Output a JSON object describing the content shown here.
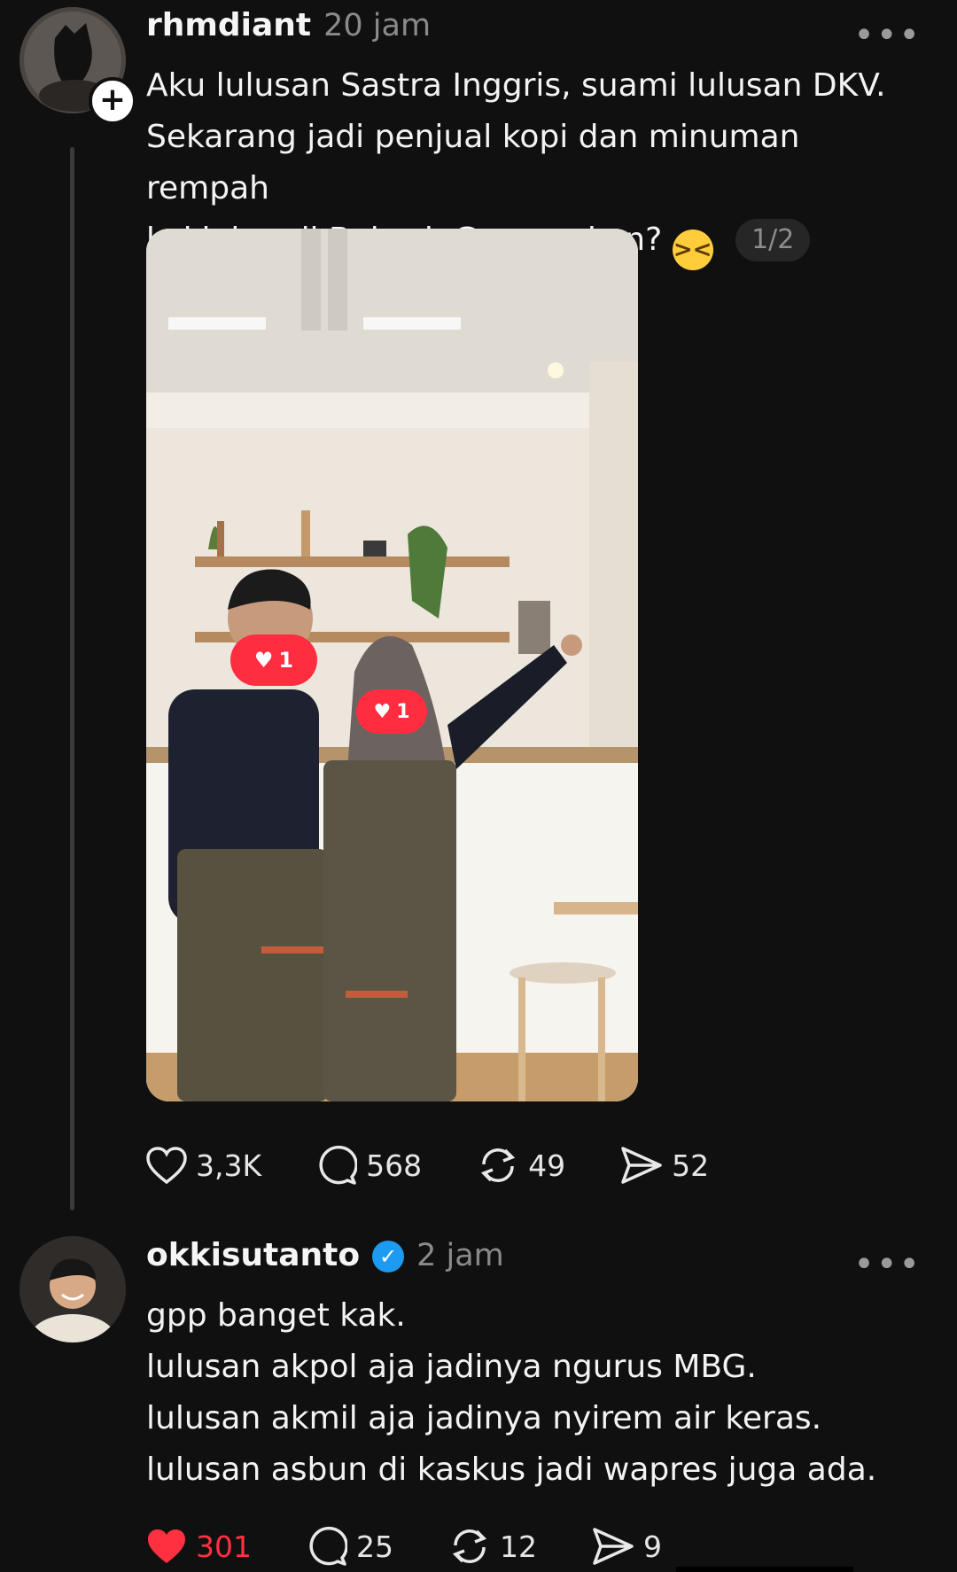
{
  "post": {
    "username": "rhmdiant",
    "time": "20 jam",
    "text_lines": [
      "Aku lulusan Sastra Inggris, suami lulusan DKV.",
      "Sekarang jadi penjual kopi dan minuman rempah",
      "kekinian di Bekasi. Gapapa kan?"
    ],
    "emoji": "laughing-face",
    "pager": "1/2",
    "photo_badges": [
      "1",
      "1"
    ],
    "stats": {
      "likes": "3,3K",
      "replies": "568",
      "reposts": "49",
      "shares": "52"
    }
  },
  "reply": {
    "username": "okkisutanto",
    "verified": true,
    "time": "2 jam",
    "text_lines": [
      "gpp banget kak.",
      "lulusan akpol aja jadinya ngurus MBG.",
      "lulusan akmil aja jadinya nyirem air keras.",
      "lulusan asbun di kaskus jadi wapres juga ada."
    ],
    "stats": {
      "likes": "301",
      "replies": "25",
      "reposts": "12",
      "shares": "9"
    }
  },
  "colors": {
    "background": "#101010",
    "like_active": "#ff3040",
    "verified": "#1d9bf0"
  }
}
